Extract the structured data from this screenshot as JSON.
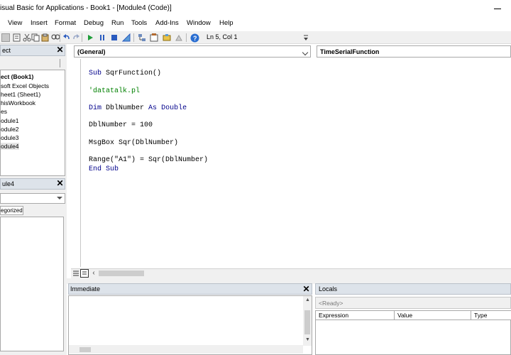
{
  "window": {
    "title": "isual Basic for Applications - Book1 - [Module4 (Code)]"
  },
  "menu": {
    "items": [
      "View",
      "Insert",
      "Format",
      "Debug",
      "Run",
      "Tools",
      "Add-Ins",
      "Window",
      "Help"
    ]
  },
  "toolbar": {
    "cursor_position": "Ln 5, Col 1",
    "icons": [
      "excel-icon",
      "insert-icon",
      "cut-icon",
      "copy-icon",
      "paste-icon",
      "find-icon",
      "undo-icon",
      "redo-icon",
      "run-icon",
      "break-icon",
      "reset-icon",
      "design-mode-icon",
      "project-explorer-icon",
      "properties-icon",
      "object-browser-icon",
      "toolbox-icon",
      "help-icon"
    ]
  },
  "project_explorer": {
    "title": "ect",
    "tree": [
      "ect (Book1)",
      "soft Excel Objects",
      "heet1 (Sheet1)",
      "hisWorkbook",
      "es",
      "odule1",
      "odule2",
      "odule3",
      "odule4"
    ]
  },
  "properties": {
    "title": "ule4",
    "tab_label": "egorized"
  },
  "code_window": {
    "object_combo": "(General)",
    "procedure_combo": "TimeSerialFunction",
    "lines": [
      {
        "kind": "sub",
        "kw": "Sub",
        "rest": " SqrFunction()"
      },
      {
        "kind": "comment",
        "text": "'datatalk.pl"
      },
      {
        "kind": "dim",
        "kw1": "Dim",
        "mid": " DblNumber ",
        "kw2": "As",
        "sp": " ",
        "kw3": "Double"
      },
      {
        "kind": "plain",
        "text": "DblNumber = 100"
      },
      {
        "kind": "plain",
        "text": "MsgBox Sqr(DblNumber)"
      },
      {
        "kind": "plain",
        "text": "Range(\"A1\") = Sqr(DblNumber)"
      },
      {
        "kind": "end",
        "kw": "End Sub"
      }
    ]
  },
  "immediate": {
    "title": "Immediate"
  },
  "locals": {
    "title": "Locals",
    "status": "<Ready>",
    "columns": [
      "Expression",
      "Value",
      "Type"
    ]
  },
  "colors": {
    "keyword": "#00008b",
    "comment": "#008000",
    "pane_header": "#dde3ea"
  }
}
